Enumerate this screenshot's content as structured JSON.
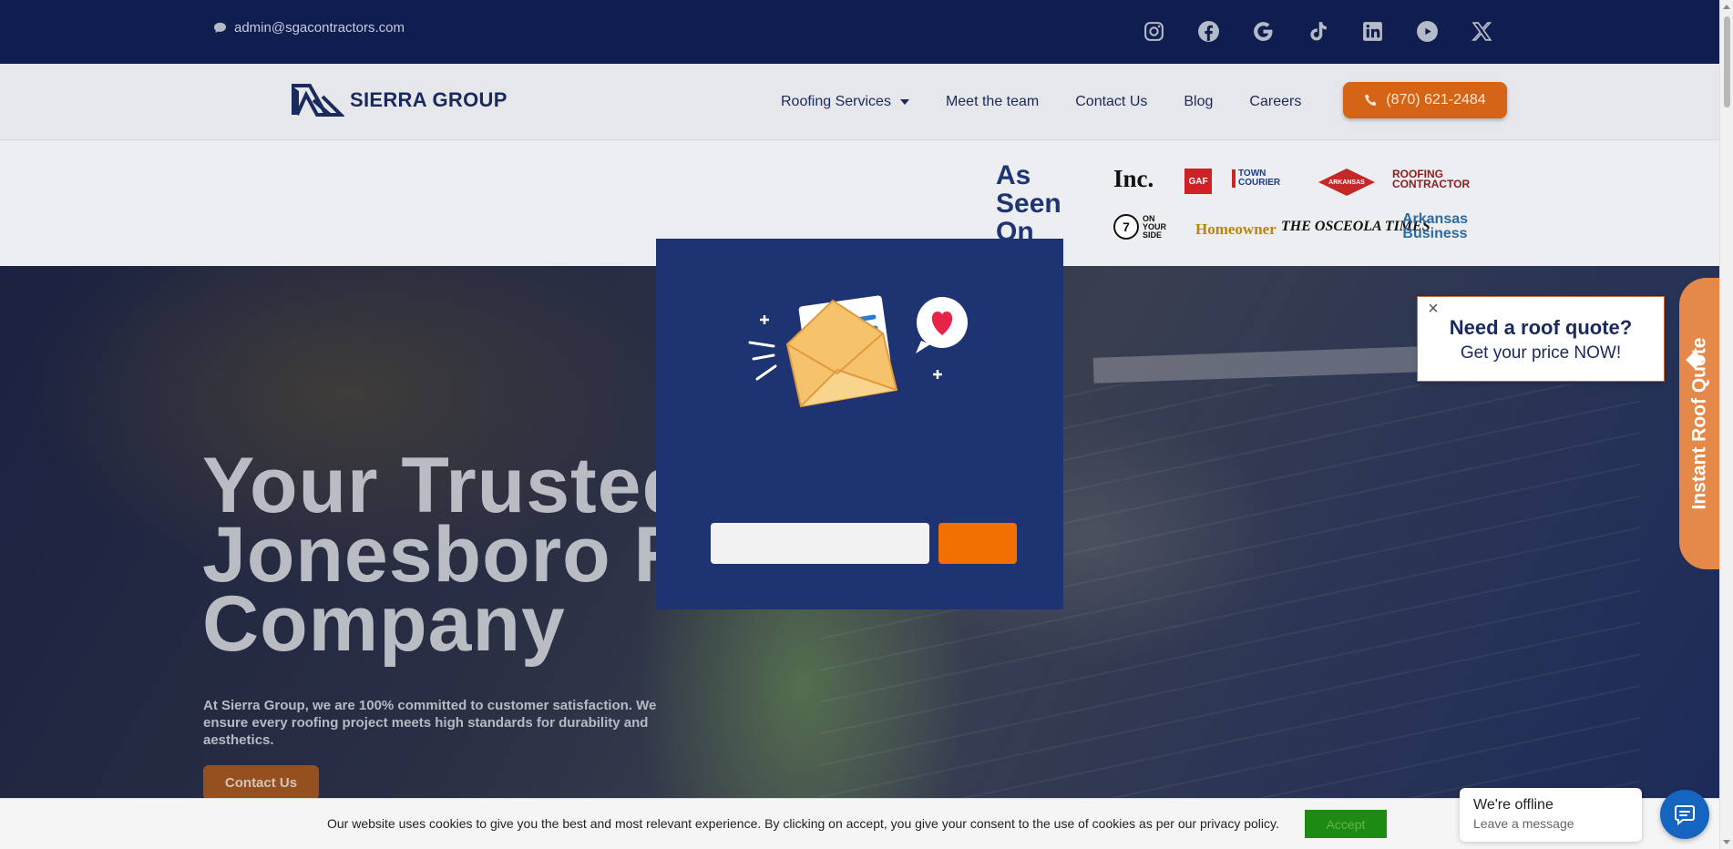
{
  "topbar": {
    "email": "admin@sgacontractors.com",
    "socials": [
      "instagram-icon",
      "facebook-icon",
      "google-icon",
      "tiktok-icon",
      "linkedin-icon",
      "youtube-icon",
      "x-icon"
    ]
  },
  "header": {
    "logo_text": "SIERRA GROUP",
    "nav": [
      {
        "label": "Roofing Services"
      },
      {
        "label": "Meet the team"
      },
      {
        "label": "Contact Us"
      },
      {
        "label": "Blog"
      },
      {
        "label": "Careers"
      }
    ],
    "phone": "(870) 621-2484"
  },
  "as_seen_on": {
    "title": "As Seen On",
    "logos": [
      "Inc.",
      "GAF",
      "TOWN COURIER",
      "ARKANSAS",
      "ROOFING CONTRACTOR",
      "ON YOUR SIDE",
      "Homeowner",
      "THE OSCEOLA TIMES",
      "Arkansas Business"
    ]
  },
  "hero": {
    "title_line1": "Your Trusted",
    "title_line2": "Jonesboro Roofing",
    "title_line3": "Company",
    "text": "At Sierra Group, we are 100% committed to customer satisfaction. We ensure every roofing project meets high standards for durability and aesthetics.",
    "button": "Contact Us"
  },
  "quote_popup": {
    "close": "×",
    "line1": "Need a roof quote?",
    "line2": "Get your price NOW!",
    "tab_label": "Instant Roof Quote"
  },
  "modal": {
    "input_placeholder": "",
    "submit_label": ""
  },
  "cookie": {
    "text": "Our website uses cookies to give you the best and most relevant experience. By clicking on accept, you give your consent to the use of cookies as per our privacy policy.",
    "accept": "Accept"
  },
  "chat": {
    "status": "We're offline",
    "sub": "Leave a message"
  },
  "colors": {
    "navy": "#0f1d4f",
    "brand_blue": "#1a2a5c",
    "orange": "#d56417",
    "modal_bg": "#1e3371"
  }
}
